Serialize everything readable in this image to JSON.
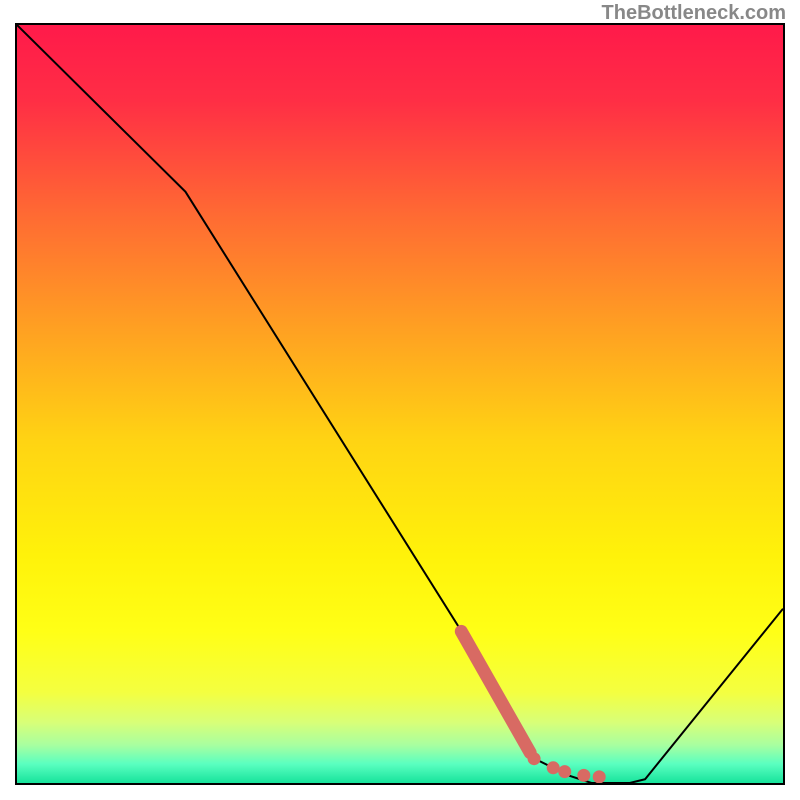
{
  "watermark": "TheBottleneck.com",
  "chart_data": {
    "type": "line",
    "title": "",
    "xlabel": "",
    "ylabel": "",
    "xlim": [
      0,
      100
    ],
    "ylim": [
      0,
      100
    ],
    "x": [
      0,
      22,
      63,
      68,
      72,
      75,
      80,
      82,
      100
    ],
    "y": [
      100,
      78,
      12,
      3,
      1,
      0,
      0,
      0.5,
      23
    ],
    "background_gradient_stops": [
      {
        "pos": 0.0,
        "color": "#ff1a4a"
      },
      {
        "pos": 0.1,
        "color": "#ff2e45"
      },
      {
        "pos": 0.25,
        "color": "#ff6a33"
      },
      {
        "pos": 0.4,
        "color": "#ffa022"
      },
      {
        "pos": 0.55,
        "color": "#ffd413"
      },
      {
        "pos": 0.7,
        "color": "#fff20a"
      },
      {
        "pos": 0.8,
        "color": "#ffff16"
      },
      {
        "pos": 0.88,
        "color": "#f4ff40"
      },
      {
        "pos": 0.92,
        "color": "#d8ff78"
      },
      {
        "pos": 0.95,
        "color": "#a8ffa0"
      },
      {
        "pos": 0.975,
        "color": "#5affc0"
      },
      {
        "pos": 1.0,
        "color": "#17e39b"
      }
    ],
    "highlight_segment": {
      "color": "#d86a63",
      "points": [
        {
          "x": 58,
          "y": 20
        },
        {
          "x": 67,
          "y": 4
        }
      ],
      "dots": [
        {
          "x": 67.5,
          "y": 3.2
        },
        {
          "x": 70,
          "y": 2
        },
        {
          "x": 71.5,
          "y": 1.5
        },
        {
          "x": 74,
          "y": 1
        },
        {
          "x": 76,
          "y": 0.8
        }
      ]
    }
  }
}
